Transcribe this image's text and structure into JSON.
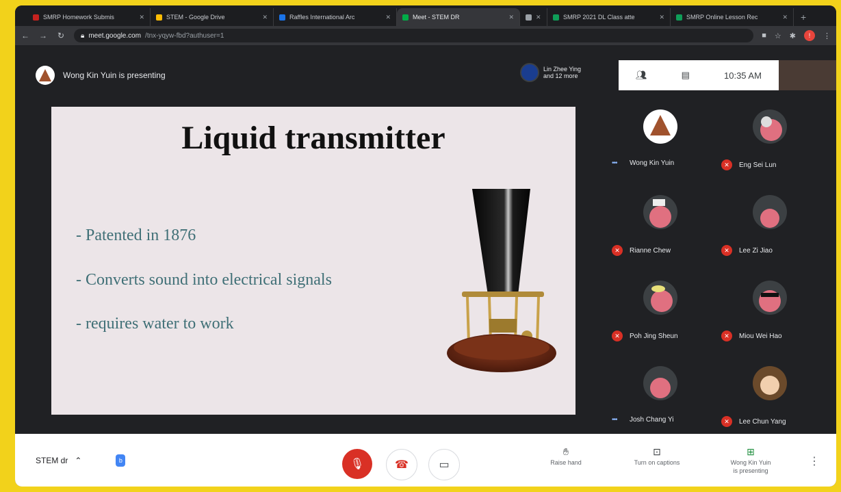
{
  "tabs": [
    {
      "label": "SMRP Homework Submis",
      "color": "#c5221f"
    },
    {
      "label": "STEM - Google Drive",
      "color": "#fbbc04"
    },
    {
      "label": "Raffles International Arc",
      "color": "#1a73e8"
    },
    {
      "label": "Meet - STEM DR",
      "color": "#00ac47",
      "active": true
    },
    {
      "label": "",
      "color": "#9aa0a6"
    },
    {
      "label": "SMRP 2021 DL Class atte",
      "color": "#0f9d58"
    },
    {
      "label": "SMRP Online Lesson Rec",
      "color": "#0f9d58"
    }
  ],
  "address": {
    "host": "meet.google.com",
    "path": "/tnx-yqyw-fbd?authuser=1"
  },
  "presenter": {
    "text": "Wong Kin Yuin is presenting"
  },
  "joined": {
    "line1": "Lin Zhee Ying",
    "line2": "and 12 more"
  },
  "clock": "10:35 AM",
  "slide": {
    "title": "Liquid transmitter",
    "bullets": [
      "- Patented in 1876",
      "- Converts sound into electrical signals",
      "- requires water to work"
    ]
  },
  "participants": [
    {
      "name": "Wong Kin Yuin",
      "status": "speaking",
      "avatar": "#ffffff"
    },
    {
      "name": "Eng Sei Lun",
      "status": "muted",
      "avatar": "#e07080"
    },
    {
      "name": "Rianne Chew",
      "status": "muted",
      "avatar": "#e07080"
    },
    {
      "name": "Lee Zi Jiao",
      "status": "muted",
      "avatar": "#e07080"
    },
    {
      "name": "Poh Jing Sheun",
      "status": "muted",
      "avatar": "#e07080"
    },
    {
      "name": "Miou Wei Hao",
      "status": "muted",
      "avatar": "#e07080"
    },
    {
      "name": "Josh Chang Yi",
      "status": "speaking",
      "avatar": "#e07080"
    },
    {
      "name": "Lee Chun Yang",
      "status": "muted",
      "avatar": "#c9a27a"
    }
  ],
  "bottom": {
    "meeting_name": "STEM dr",
    "raise_hand": "Raise hand",
    "captions": "Turn on captions",
    "presenting_line1": "Wong Kin Yuin",
    "presenting_line2": "is presenting"
  },
  "colors": {
    "end_call": "#d93025",
    "muted": "#d93025",
    "accent": "#4285f4"
  }
}
